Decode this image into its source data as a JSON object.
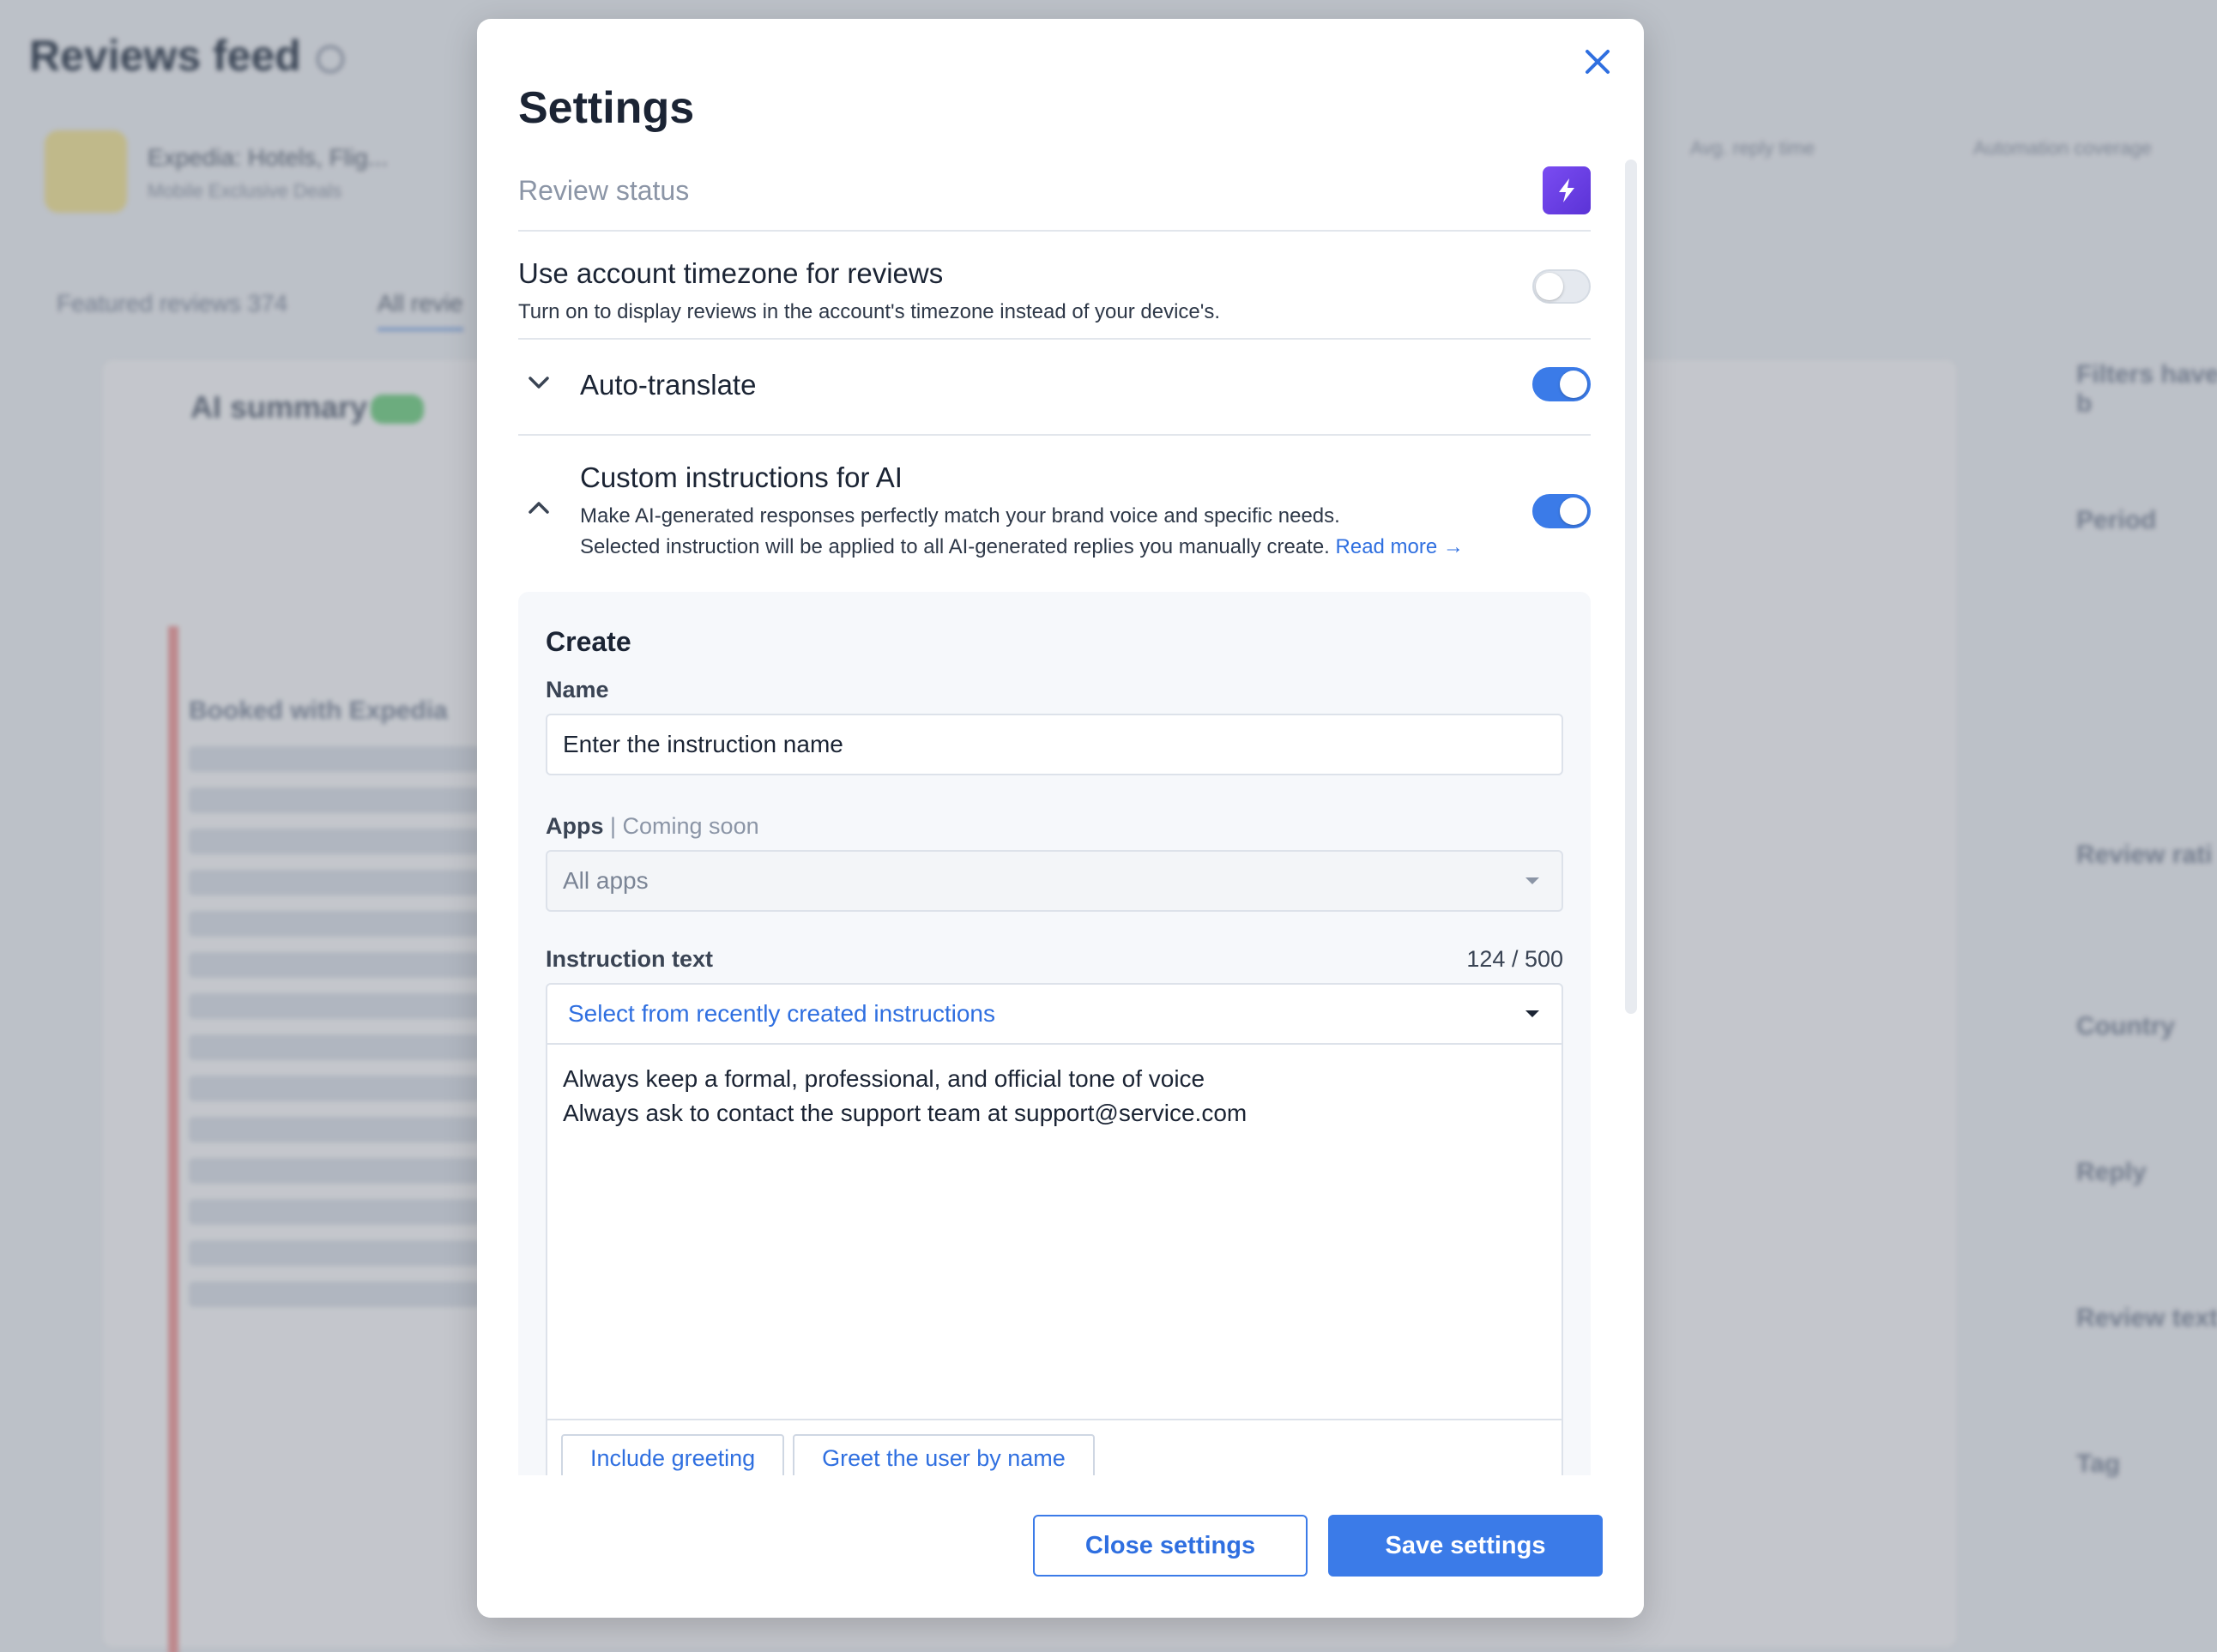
{
  "background": {
    "page_title": "Reviews feed",
    "app_name": "Expedia: Hotels, Flig...",
    "app_sub": "Mobile Exclusive Deals",
    "tab_featured": "Featured reviews  374",
    "tab_all": "All revie",
    "ai_summary": "AI summary",
    "review_title": "Booked with Expedia",
    "stat_reply_time": "Avg. reply time",
    "stat_automation": "Automation coverage",
    "filters_title": "Filters have b",
    "filter_period": "Period",
    "filter_rating": "Review rati",
    "filter_country": "Country",
    "filter_reply": "Reply",
    "filter_text": "Review text",
    "filter_tag": "Tag"
  },
  "modal": {
    "title": "Settings",
    "review_status_label": "Review status",
    "timezone": {
      "title": "Use account timezone for reviews",
      "description": "Turn on to display reviews in the account's timezone instead of your device's.",
      "enabled": false
    },
    "auto_translate": {
      "title": "Auto-translate",
      "enabled": true
    },
    "custom_instructions": {
      "title": "Custom instructions for AI",
      "description1": "Make AI-generated responses perfectly match your brand voice and specific needs.",
      "description2": "Selected instruction will be applied to all AI-generated replies you manually create.",
      "read_more": "Read more →",
      "enabled": true
    },
    "create": {
      "heading": "Create",
      "name_label": "Name",
      "name_value": "Enter the instruction name",
      "apps_label": "Apps",
      "apps_soon": " | Coming soon",
      "apps_value": "All apps",
      "instruction_label": "Instruction text",
      "counter": "124 / 500",
      "select_recent": "Select from recently created instructions",
      "instruction_line1": "Always keep a formal, professional, and official tone of voice",
      "instruction_line2": "Always ask to contact the support team at support@service.com",
      "chip1": "Include greeting",
      "chip2": "Greet the user by name"
    },
    "footer": {
      "close_label": "Close settings",
      "save_label": "Save settings"
    }
  },
  "colors": {
    "accent": "#3b7be8",
    "bolt_gradient_start": "#7a4cf2",
    "bolt_gradient_end": "#5b33d6"
  }
}
